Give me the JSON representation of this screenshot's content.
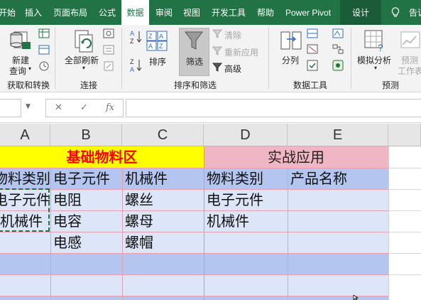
{
  "ribbon_tabs": [
    "开始",
    "插入",
    "页面布局",
    "公式",
    "数据",
    "审阅",
    "视图",
    "开发工具",
    "帮助",
    "Power Pivot",
    "设计",
    "告诉"
  ],
  "ribbon": {
    "get_transform": {
      "new_query_line1": "新建",
      "new_query_line2": "查询",
      "label": "获取和转换"
    },
    "connections": {
      "refresh_all": "全部刷新",
      "label": "连接"
    },
    "sort_filter": {
      "sort": "排序",
      "filter": "筛选",
      "clear": "清除",
      "reapply": "重新应用",
      "advanced": "高级",
      "label": "排序和筛选"
    },
    "data_tools": {
      "text_to_columns": "分列",
      "label": "数据工具"
    },
    "forecast": {
      "what_if": "模拟分析",
      "forecast_sheet_line1": "预测",
      "forecast_sheet_line2": "工作表",
      "label": "预测"
    }
  },
  "formula_bar": {
    "cancel": "✕",
    "enter": "✓",
    "fx": "fx",
    "value": ""
  },
  "columns": [
    "A",
    "B",
    "C",
    "D",
    "E"
  ],
  "sheet": {
    "header_left": "基础物料区",
    "header_right": "实战应用",
    "rows": [
      [
        "物料类别",
        "电子元件",
        "机械件",
        "物料类别",
        "产品名称"
      ],
      [
        "电子元件",
        "电阻",
        "螺丝",
        "电子元件",
        ""
      ],
      [
        "机械件",
        "电容",
        "螺母",
        "机械件",
        ""
      ],
      [
        "",
        "电感",
        "螺帽",
        "",
        ""
      ]
    ]
  },
  "colors": {
    "ribbon_green": "#217346",
    "header_left_bg": "#ffff00",
    "header_left_text": "#ff0000",
    "header_right_bg": "#f0b6c4",
    "band_blue": "#b4c6f0",
    "band_light": "#dde5f8"
  }
}
